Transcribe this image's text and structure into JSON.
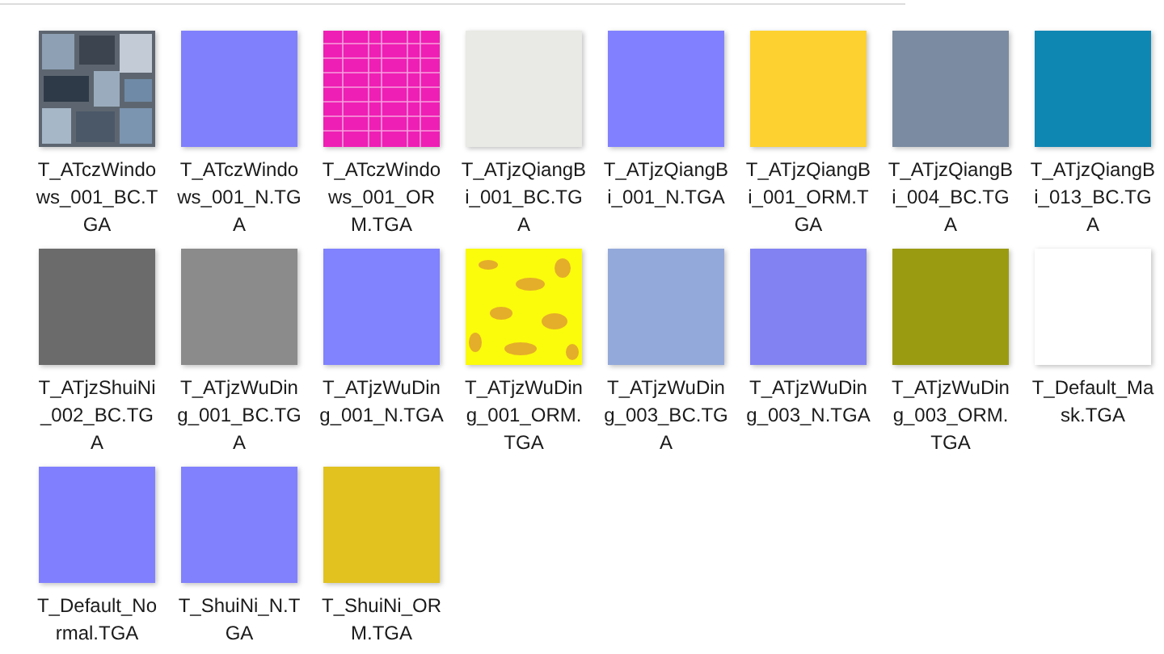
{
  "files": [
    {
      "name": "T_ATczWindows_001_BC.TGA",
      "kind": "picture"
    },
    {
      "name": "T_ATczWindows_001_N.TGA",
      "kind": "flat",
      "color": "#8080fc"
    },
    {
      "name": "T_ATczWindows_001_ORM.TGA",
      "kind": "grid",
      "color": "#ee1fb4"
    },
    {
      "name": "T_ATjzQiangBi_001_BC.TGA",
      "kind": "flat",
      "color": "#e9e9e5"
    },
    {
      "name": "T_ATjzQiangBi_001_N.TGA",
      "kind": "flat",
      "color": "#8181ff"
    },
    {
      "name": "T_ATjzQiangBi_001_ORM.TGA",
      "kind": "flat",
      "color": "#fdd12f"
    },
    {
      "name": "T_ATjzQiangBi_004_BC.TGA",
      "kind": "flat",
      "color": "#7b8ba1"
    },
    {
      "name": "T_ATjzQiangBi_013_BC.TGA",
      "kind": "flat",
      "color": "#0f87b3"
    },
    {
      "name": "T_ATjzShuiNi_002_BC.TGA",
      "kind": "flat",
      "color": "#6b6b6b"
    },
    {
      "name": "T_ATjzWuDing_001_BC.TGA",
      "kind": "flat",
      "color": "#8b8b8b"
    },
    {
      "name": "T_ATjzWuDing_001_N.TGA",
      "kind": "flat",
      "color": "#8082fe"
    },
    {
      "name": "T_ATjzWuDing_001_ORM.TGA",
      "kind": "blotch",
      "color": "#fbfb0c"
    },
    {
      "name": "T_ATjzWuDing_003_BC.TGA",
      "kind": "flat",
      "color": "#93a9da"
    },
    {
      "name": "T_ATjzWuDing_003_N.TGA",
      "kind": "flat",
      "color": "#8282f2"
    },
    {
      "name": "T_ATjzWuDing_003_ORM.TGA",
      "kind": "flat",
      "color": "#9b9b12"
    },
    {
      "name": "T_Default_Mask.TGA",
      "kind": "flat",
      "color": "#ffffff"
    },
    {
      "name": "T_Default_Normal.TGA",
      "kind": "flat",
      "color": "#8080ff"
    },
    {
      "name": "T_ShuiNi_N.TGA",
      "kind": "flat",
      "color": "#8181fd"
    },
    {
      "name": "T_ShuiNi_ORM.TGA",
      "kind": "flat",
      "color": "#e1c21f"
    }
  ]
}
